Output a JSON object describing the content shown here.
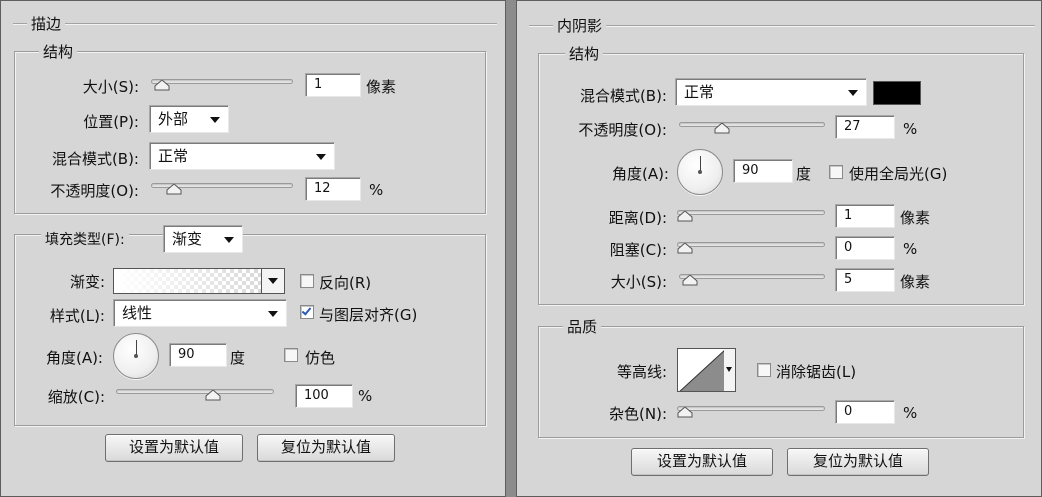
{
  "stroke": {
    "title": "描边",
    "structure": {
      "title": "结构",
      "size_label": "大小(S):",
      "size_value": "1",
      "size_unit": "像素",
      "size_level": 0.02,
      "position_label": "位置(P):",
      "position_value": "外部",
      "blend_label": "混合模式(B):",
      "blend_value": "正常",
      "opacity_label": "不透明度(O):",
      "opacity_value": "12",
      "opacity_unit": "%",
      "opacity_level": 0.12
    },
    "fill": {
      "type_label": "填充类型(F):",
      "type_value": "渐变",
      "gradient_label": "渐变:",
      "reverse_label": "反向(R)",
      "reverse_checked": false,
      "style_label": "样式(L):",
      "style_value": "线性",
      "align_label": "与图层对齐(G)",
      "align_checked": true,
      "angle_label": "角度(A):",
      "angle_value": "90",
      "angle_unit": "度",
      "dither_label": "仿色",
      "dither_checked": false,
      "scale_label": "缩放(C):",
      "scale_value": "100",
      "scale_unit": "%",
      "scale_level": 0.63
    },
    "buttons": {
      "make_default": "设置为默认值",
      "reset_default": "复位为默认值"
    }
  },
  "inner_shadow": {
    "title": "内阴影",
    "structure": {
      "title": "结构",
      "blend_label": "混合模式(B):",
      "blend_value": "正常",
      "shadow_color": "#000000",
      "opacity_label": "不透明度(O):",
      "opacity_value": "27",
      "opacity_unit": "%",
      "opacity_level": 0.27,
      "angle_label": "角度(A):",
      "angle_value": "90",
      "angle_unit": "度",
      "global_light_label": "使用全局光(G)",
      "global_light_checked": false,
      "distance_label": "距离(D):",
      "distance_value": "1",
      "distance_unit": "像素",
      "distance_level": 0.0,
      "choke_label": "阻塞(C):",
      "choke_value": "0",
      "choke_unit": "%",
      "choke_level": 0.0,
      "size_label": "大小(S):",
      "size_value": "5",
      "size_unit": "像素",
      "size_level": 0.02
    },
    "quality": {
      "title": "品质",
      "contour_label": "等高线:",
      "antialias_label": "消除锯齿(L)",
      "antialias_checked": false,
      "noise_label": "杂色(N):",
      "noise_value": "0",
      "noise_unit": "%",
      "noise_level": 0.0
    },
    "buttons": {
      "make_default": "设置为默认值",
      "reset_default": "复位为默认值"
    }
  }
}
